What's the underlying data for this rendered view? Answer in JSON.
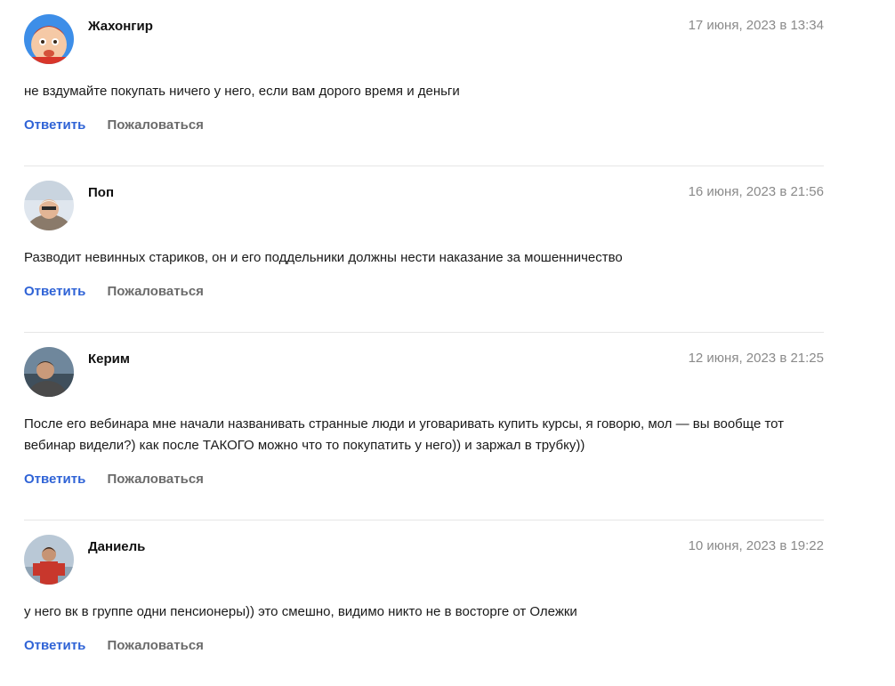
{
  "colors": {
    "reply_link": "#2f63d6",
    "report_link": "#6b6b6b",
    "date_text": "#8a8a8a",
    "divider": "#e6e6e6"
  },
  "comments": [
    {
      "author": "Жахонгир",
      "date": "17 июня, 2023 в 13:34",
      "text": "не вздумайте покупать ничего у него, если вам дорого время и деньги",
      "reply_label": "Ответить",
      "report_label": "Пожаловаться",
      "avatar_icon": "cartoon-baby-avatar-icon"
    },
    {
      "author": "Поп",
      "date": "16 июня, 2023 в 21:56",
      "text": "Разводит невинных стариков, он и его поддельники должны нести наказание за мошенничество",
      "reply_label": "Ответить",
      "report_label": "Пожаловаться",
      "avatar_icon": "user-photo-avatar-icon"
    },
    {
      "author": "Керим",
      "date": "12 июня, 2023 в 21:25",
      "text": "После его вебинара мне начали названивать странные люди и уговаривать купить курсы, я говорю, мол — вы вообще тот вебинар видели?) как после ТАКОГО можно что то покупатить у него)) и заржал в трубку))",
      "reply_label": "Ответить",
      "report_label": "Пожаловаться",
      "avatar_icon": "user-photo-avatar-icon"
    },
    {
      "author": "Даниель",
      "date": "10 июня, 2023 в 19:22",
      "text": "у него вк в группе одни пенсионеры)) это смешно, видимо никто не в восторге от Олежки",
      "reply_label": "Ответить",
      "report_label": "Пожаловаться",
      "avatar_icon": "user-photo-avatar-icon"
    }
  ]
}
